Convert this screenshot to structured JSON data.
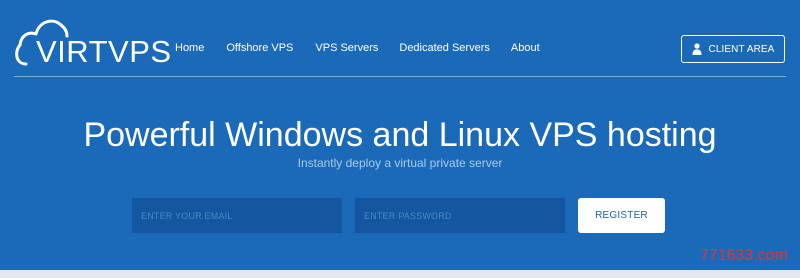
{
  "brand": {
    "logo_text": "VIRTVPS"
  },
  "nav": {
    "items": [
      {
        "label": "Home"
      },
      {
        "label": "Offshore VPS"
      },
      {
        "label": "VPS Servers"
      },
      {
        "label": "Dedicated Servers"
      },
      {
        "label": "About"
      }
    ]
  },
  "header": {
    "client_area_label": "CLIENT AREA",
    "client_area_icon": "user-icon"
  },
  "hero": {
    "title": "Powerful Windows and Linux VPS hosting",
    "subtitle": "Instantly deploy a virtual private server"
  },
  "form": {
    "email_placeholder": "ENTER YOUR EMAIL",
    "password_placeholder": "ENTER PASSWORD",
    "email_value": "",
    "password_value": "",
    "register_label": "REGISTER"
  },
  "watermark": {
    "text": "771633.com"
  },
  "colors": {
    "background": "#1b6ab9",
    "input_background": "#1457a0",
    "button_text": "#1b5f9e",
    "watermark": "#e7322c"
  }
}
